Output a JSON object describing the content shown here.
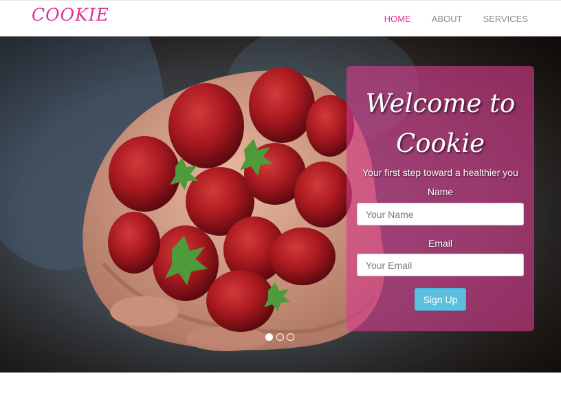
{
  "brand": {
    "logo_text": "COOKIE",
    "accent_color": "#e0308f"
  },
  "nav": {
    "items": [
      {
        "label": "HOME",
        "active": true
      },
      {
        "label": "ABOUT",
        "active": false
      },
      {
        "label": "SERVICES",
        "active": false
      }
    ]
  },
  "hero": {
    "image": "strawberries-in-hands",
    "carousel": {
      "slide_count": 3,
      "active_index": 0
    }
  },
  "signup_panel": {
    "title_line1": "Welcome to",
    "title_line2": "Cookie",
    "subtitle": "Your first step toward a healthier you",
    "name_label": "Name",
    "name_placeholder": "Your Name",
    "email_label": "Email",
    "email_placeholder": "Your Email",
    "submit_label": "Sign Up",
    "panel_color": "#d63c8c",
    "button_color": "#5bc0de"
  }
}
